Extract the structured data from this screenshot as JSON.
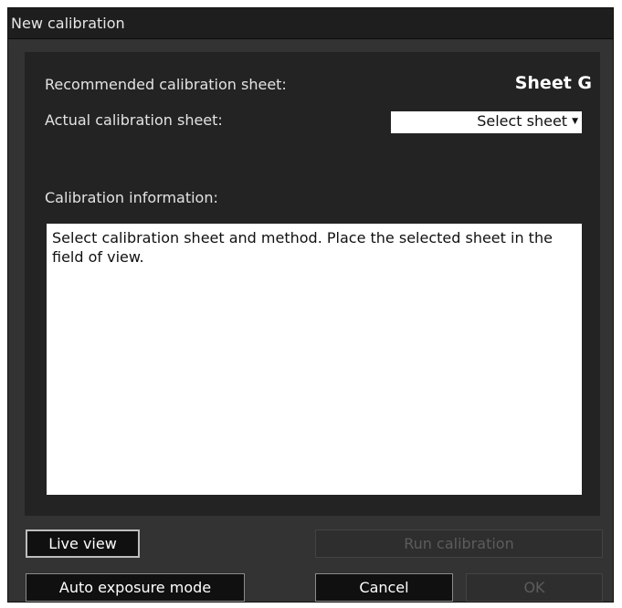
{
  "window": {
    "title": "New calibration"
  },
  "calibration": {
    "recommended_label": "Recommended calibration sheet:",
    "recommended_value": "Sheet G",
    "actual_label": "Actual calibration sheet:",
    "actual_select_value": "Select sheet",
    "info_label": "Calibration information:",
    "info_text": "Select calibration sheet and method. Place the selected sheet in the field of view."
  },
  "buttons": {
    "live_view": "Live view",
    "run_calibration": "Run calibration",
    "auto_exposure_mode": "Auto exposure mode",
    "cancel": "Cancel",
    "ok": "OK"
  },
  "icons": {
    "dropdown": "chevron-down-icon"
  }
}
